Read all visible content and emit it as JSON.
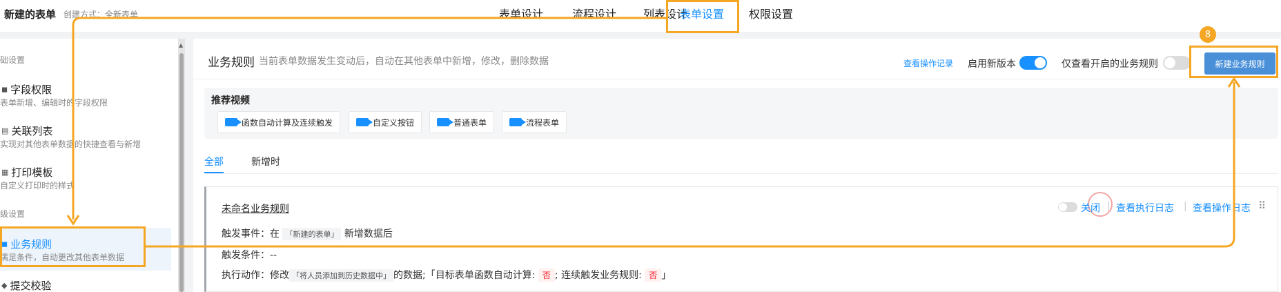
{
  "header": {
    "form_title": "新建的表单",
    "create_mode": "创建方式：全新表单",
    "tabs": [
      {
        "label": "表单设计"
      },
      {
        "label": "流程设计"
      },
      {
        "label": "列表设计"
      },
      {
        "label": "表单设置"
      },
      {
        "label": "权限设置"
      }
    ],
    "active_tab": "表单设置"
  },
  "sidebar": {
    "sections": [
      {
        "title": "础设置"
      },
      {
        "title": "级设置"
      }
    ],
    "items": [
      {
        "title": "字段权限",
        "desc": "表单新增、编辑时的字段权限"
      },
      {
        "title": "关联列表",
        "desc": "实现对其他表单数据的快捷查看与新增"
      },
      {
        "title": "打印模板",
        "desc": "自定义打印时的样式"
      },
      {
        "title": "业务规则",
        "desc": "满足条件，自动更改其他表单数据"
      },
      {
        "title": "提交校验",
        "desc": ""
      }
    ],
    "active_item": "业务规则"
  },
  "main": {
    "title": "业务规则",
    "desc": "当前表单数据发生变动后，自动在其他表单中新增，修改，删除数据",
    "op_log_link": "查看操作记录",
    "enable_new_version_label": "启用新版本",
    "enable_new_version": true,
    "only_enabled_label": "仅查看开启的业务规则",
    "only_enabled": false,
    "new_rule_button": "新建业务规则",
    "step_badge": "8",
    "recommend": {
      "title": "推荐视频",
      "videos": [
        "函数自动计算及连续触发",
        "自定义按钮",
        "普通表单",
        "流程表单"
      ]
    },
    "tabs": [
      "全部",
      "新增时"
    ],
    "active_tab": "全部"
  },
  "rule": {
    "name": "未命名业务规则",
    "trigger_event_label": "触发事件：",
    "trigger_event_prefix": "在",
    "trigger_event_form": "「新建的表单」",
    "trigger_event_suffix": "新增数据后",
    "trigger_condition_label": "触发条件：",
    "trigger_condition_value": "--",
    "action_label": "执行动作：",
    "action_prefix": "修改",
    "action_target": "「将人员添加到历史数据中」",
    "action_mid": "的数据;「目标表单函数自动计算:",
    "action_val1": "否",
    "action_mid2": "; 连续触发业务规则:",
    "action_val2": "否",
    "action_end": "」",
    "enabled": false,
    "status_label": "关闭",
    "exec_log_link": "查看执行日志",
    "op_log_link": "查看操作日志",
    "separator": "|"
  },
  "colors": {
    "accent": "#1890ff",
    "highlight": "#f5a623",
    "button": "#4a90d9"
  }
}
